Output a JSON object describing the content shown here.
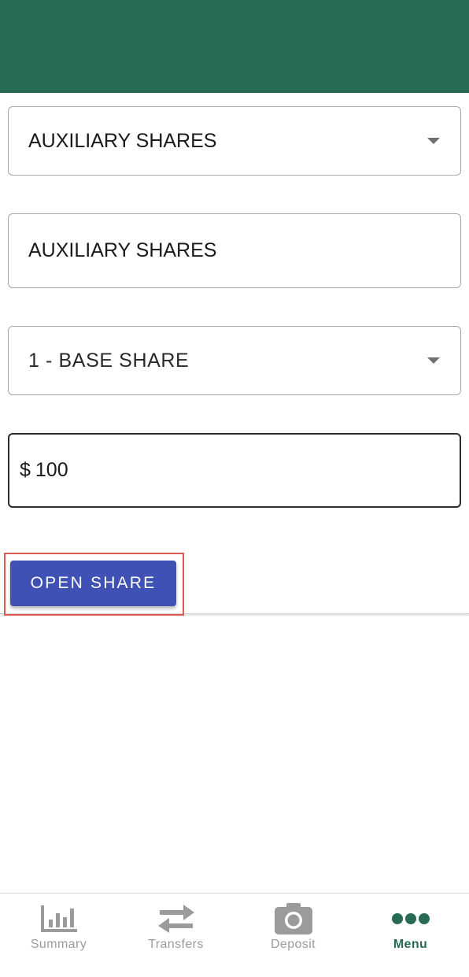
{
  "form": {
    "account_type_selected": "AUXILIARY SHARES",
    "share_name_value": "AUXILIARY SHARES",
    "source_account_selected": "1 - BASE SHARE",
    "amount_currency": "$",
    "amount_value": "100",
    "open_button_label": "OPEN SHARE"
  },
  "nav": {
    "items": [
      {
        "label": "Summary",
        "icon": "bar-chart-icon"
      },
      {
        "label": "Transfers",
        "icon": "transfer-arrows-icon"
      },
      {
        "label": "Deposit",
        "icon": "camera-icon"
      },
      {
        "label": "Menu",
        "icon": "more-dots-icon"
      }
    ],
    "active": "Menu"
  },
  "colors": {
    "header": "#276b52",
    "primary_button": "#3f51b5",
    "nav_active": "#276b52",
    "nav_inactive": "#9b9b9b",
    "highlight": "#e05a50"
  }
}
